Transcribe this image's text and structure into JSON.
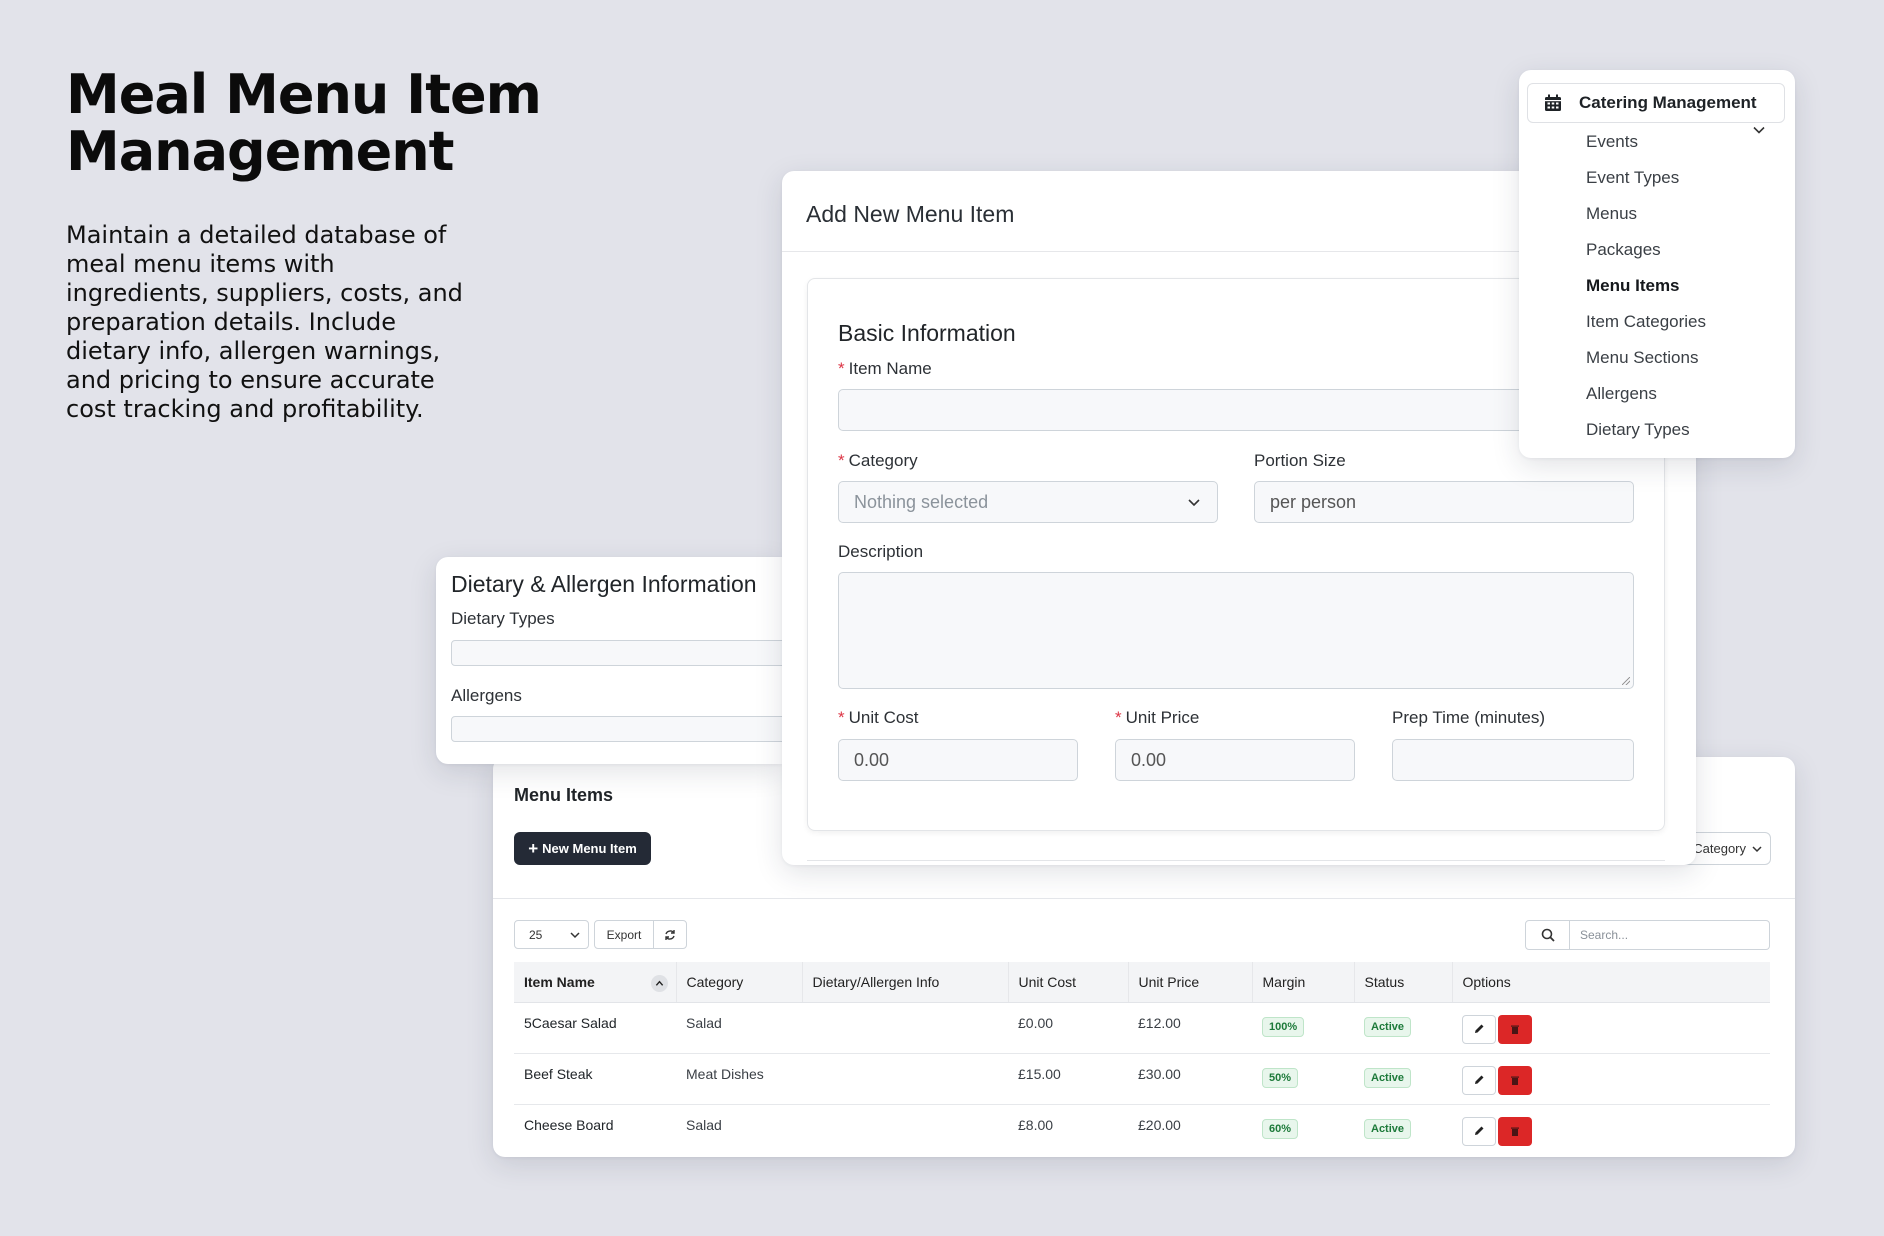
{
  "hero": {
    "title": "Meal Menu Item Management",
    "description": "Maintain a detailed database of meal menu items with ingredients, suppliers, costs, and preparation details. Include dietary info, allergen warnings, and pricing to ensure accurate cost tracking and profitability."
  },
  "nav": {
    "header": "Catering Management",
    "header_icon": "calendar-icon",
    "items": [
      {
        "label": "Events",
        "active": false
      },
      {
        "label": "Event Types",
        "active": false
      },
      {
        "label": "Menus",
        "active": false
      },
      {
        "label": "Packages",
        "active": false
      },
      {
        "label": "Menu Items",
        "active": true
      },
      {
        "label": "Item Categories",
        "active": false
      },
      {
        "label": "Menu Sections",
        "active": false
      },
      {
        "label": "Allergens",
        "active": false
      },
      {
        "label": "Dietary Types",
        "active": false
      }
    ]
  },
  "modal": {
    "title": "Add New Menu Item",
    "section_title": "Basic Information",
    "item_name": {
      "label": "Item Name",
      "value": ""
    },
    "category": {
      "label": "Category",
      "placeholder": "Nothing selected"
    },
    "portion_size": {
      "label": "Portion Size",
      "value": "per person"
    },
    "description": {
      "label": "Description",
      "value": ""
    },
    "unit_cost": {
      "label": "Unit Cost",
      "value": "0.00"
    },
    "unit_price": {
      "label": "Unit Price",
      "value": "0.00"
    },
    "prep_time": {
      "label": "Prep Time (minutes)",
      "value": ""
    }
  },
  "dietary": {
    "title": "Dietary & Allergen Information",
    "dietary_types_label": "Dietary Types",
    "allergens_label": "Allergens"
  },
  "table_card": {
    "title": "Menu Items",
    "new_button": "New Menu Item",
    "category_filter": "Category",
    "page_size": "25",
    "export_label": "Export",
    "search_placeholder": "Search...",
    "columns": [
      "Item Name",
      "Category",
      "Dietary/Allergen Info",
      "Unit Cost",
      "Unit Price",
      "Margin",
      "Status",
      "Options"
    ],
    "rows": [
      {
        "name": "5Caesar Salad",
        "category": "Salad",
        "dietary": "",
        "unit_cost": "£0.00",
        "unit_price": "£12.00",
        "margin": "100%",
        "status": "Active"
      },
      {
        "name": "Beef Steak",
        "category": "Meat Dishes",
        "dietary": "",
        "unit_cost": "£15.00",
        "unit_price": "£30.00",
        "margin": "50%",
        "status": "Active"
      },
      {
        "name": "Cheese Board",
        "category": "Salad",
        "dietary": "",
        "unit_cost": "£8.00",
        "unit_price": "£20.00",
        "margin": "60%",
        "status": "Active"
      }
    ]
  },
  "colors": {
    "background": "#e2e3ea",
    "primary_button": "#242a36",
    "danger": "#dc2727",
    "required": "#dc3545",
    "success_badge": "#1d7a3a"
  }
}
